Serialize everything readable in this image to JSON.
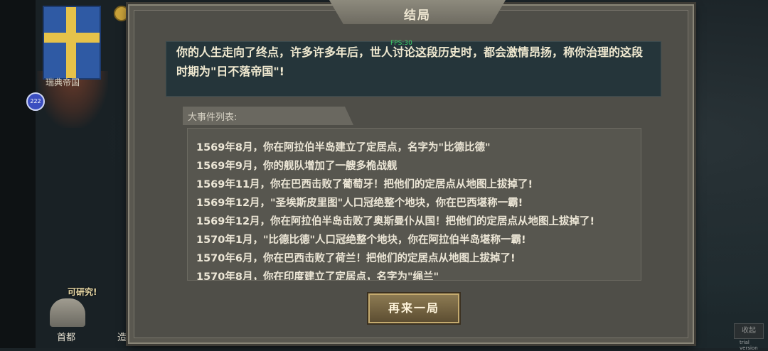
{
  "background": {
    "country_name": "瑞典帝国",
    "research_tag": "可研究!",
    "capital_label": "首都",
    "build_label": "造",
    "collapse_label": "收起",
    "trial_label": "trial version",
    "pin_label": "222"
  },
  "dialog": {
    "title": "结局",
    "fps_tag": "FPS:30",
    "summary": "你的人生走向了终点，许多许多年后，世人讨论这段历史时，都会激情昂扬，称你治理的这段时期为\"日不落帝国\"!",
    "events_header": "大事件列表:",
    "events": [
      "1569年8月，你在阿拉伯半岛建立了定居点，名字为\"比德比德\"",
      "1569年9月，你的舰队增加了一艘多桅战舰",
      "1569年11月，你在巴西击败了葡萄牙！把他们的定居点从地图上拔掉了!",
      "1569年12月，\"圣埃斯皮里图\"人口冠绝整个地块，你在巴西堪称一霸!",
      "1569年12月，你在阿拉伯半岛击败了奥斯曼仆从国！把他们的定居点从地图上拔掉了!",
      "1570年1月，\"比德比德\"人口冠绝整个地块，你在阿拉伯半岛堪称一霸!",
      "1570年6月，你在巴西击败了荷兰！把他们的定居点从地图上拔掉了!",
      "1570年8月，你在印度建立了定居点，名字为\"绳兰\""
    ],
    "restart_label": "再来一局"
  },
  "colors": {
    "summary_bg": "#25353a",
    "button_bg": "#7a6a45",
    "text_light": "#f0e9d0"
  }
}
